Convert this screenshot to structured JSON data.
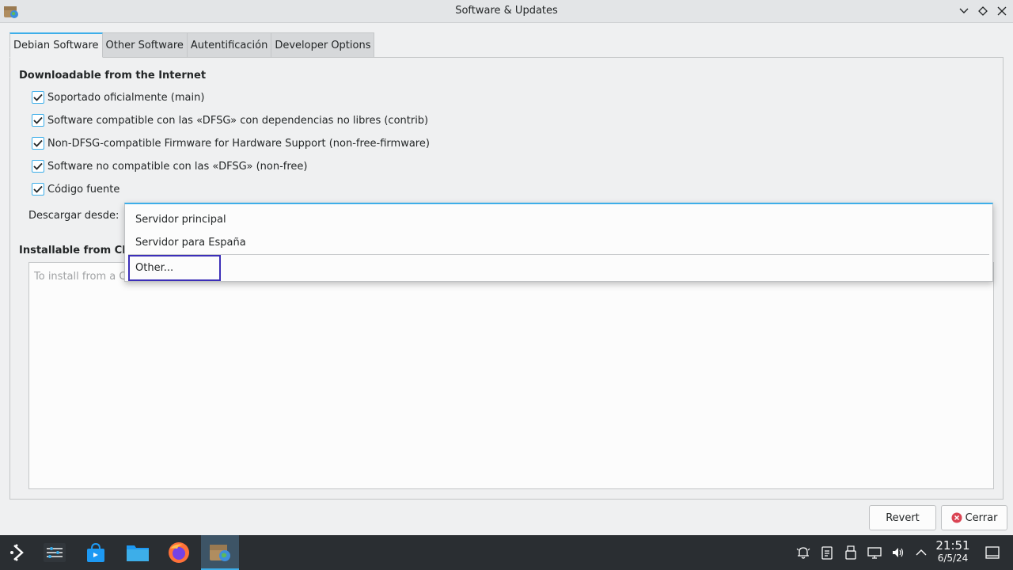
{
  "window": {
    "title": "Software & Updates",
    "buttons": [
      "minimize",
      "maximize",
      "close"
    ]
  },
  "tabs": [
    {
      "label": "Debian Software",
      "active": true
    },
    {
      "label": "Other Software",
      "active": false
    },
    {
      "label": "Autentificación",
      "active": false
    },
    {
      "label": "Developer Options",
      "active": false
    }
  ],
  "internet": {
    "heading": "Downloadable from the Internet",
    "components": [
      {
        "label": "Soportado oficialmente (main)",
        "checked": true
      },
      {
        "label": "Software compatible con las «DFSG» con dependencias no libres (contrib)",
        "checked": true
      },
      {
        "label": "Non-DFSG-compatible Firmware for Hardware Support (non-free-firmware)",
        "checked": true
      },
      {
        "label": "Software no compatible con las «DFSG» (non-free)",
        "checked": true
      },
      {
        "label": "Código fuente",
        "checked": true
      }
    ],
    "download_from_label": "Descargar desde:"
  },
  "server_dropdown": {
    "options": [
      "Servidor principal",
      "Servidor para España",
      "Other..."
    ],
    "focused": "Other..."
  },
  "cdrom": {
    "heading": "Installable from CD-",
    "placeholder": "To install from a CD"
  },
  "footer": {
    "revert_label": "Revert",
    "close_label": "Cerrar"
  },
  "taskbar": {
    "apps": [
      "application-launcher-icon",
      "system-settings-icon",
      "discover-store-icon",
      "file-manager-icon",
      "firefox-icon",
      "software-updates-icon"
    ],
    "tray": [
      "notifications-icon",
      "clipboard-icon",
      "usb-device-icon",
      "network-icon",
      "volume-icon",
      "tray-expand-icon"
    ],
    "time": "21:51",
    "date": "6/5/24"
  },
  "colors": {
    "accent": "#3daee9",
    "focus_ring": "#3c2fb8",
    "taskbar": "#2a2e32",
    "close_red": "#da4453"
  }
}
